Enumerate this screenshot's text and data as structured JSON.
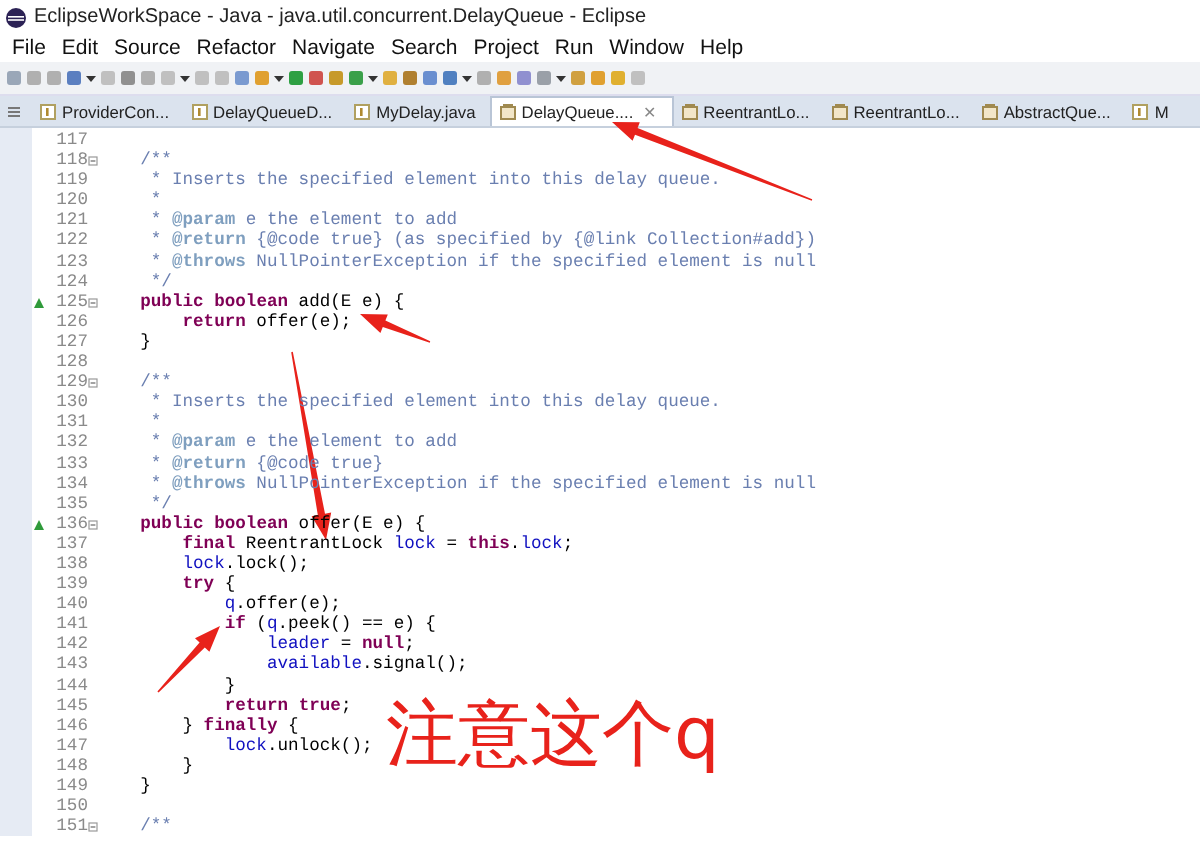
{
  "window": {
    "title": "EclipseWorkSpace - Java - java.util.concurrent.DelayQueue - Eclipse"
  },
  "menu": [
    "File",
    "Edit",
    "Source",
    "Refactor",
    "Navigate",
    "Search",
    "Project",
    "Run",
    "Window",
    "Help"
  ],
  "tabs": [
    {
      "label": "ProviderCon...",
      "kind": "source",
      "selected": false
    },
    {
      "label": "DelayQueueD...",
      "kind": "source",
      "selected": false
    },
    {
      "label": "MyDelay.java",
      "kind": "source",
      "selected": false
    },
    {
      "label": "DelayQueue....",
      "kind": "class",
      "selected": true,
      "close": "✕"
    },
    {
      "label": "ReentrantLo...",
      "kind": "class",
      "selected": false
    },
    {
      "label": "ReentrantLo...",
      "kind": "class",
      "selected": false
    },
    {
      "label": "AbstractQue...",
      "kind": "class",
      "selected": false
    },
    {
      "label": "M",
      "kind": "source",
      "selected": false
    }
  ],
  "editor": {
    "lines": [
      {
        "n": "117",
        "fold": false,
        "override": false
      },
      {
        "n": "118",
        "fold": true,
        "override": false,
        "tokens": [
          {
            "kind": "comment",
            "text": "    /**"
          }
        ]
      },
      {
        "n": "119",
        "fold": false,
        "override": false,
        "tokens": [
          {
            "kind": "comment",
            "text": "     * Inserts the specified element into this delay queue."
          }
        ]
      },
      {
        "n": "120",
        "fold": false,
        "override": false,
        "tokens": [
          {
            "kind": "comment",
            "text": "     *"
          }
        ]
      },
      {
        "n": "121",
        "fold": false,
        "override": false,
        "tokens": [
          {
            "kind": "comment",
            "text": "     * "
          },
          {
            "kind": "tag",
            "text": "@param"
          },
          {
            "kind": "comment",
            "text": " e the element to add"
          }
        ]
      },
      {
        "n": "122",
        "fold": false,
        "override": false,
        "tokens": [
          {
            "kind": "comment",
            "text": "     * "
          },
          {
            "kind": "tag",
            "text": "@return"
          },
          {
            "kind": "comment",
            "text": " {@code true} (as specified by {@link Collection#add})"
          }
        ]
      },
      {
        "n": "123",
        "fold": false,
        "override": false,
        "tokens": [
          {
            "kind": "comment",
            "text": "     * "
          },
          {
            "kind": "tag",
            "text": "@throws"
          },
          {
            "kind": "comment",
            "text": " NullPointerException if the specified element is null"
          }
        ]
      },
      {
        "n": "124",
        "fold": false,
        "override": false,
        "tokens": [
          {
            "kind": "comment",
            "text": "     */"
          }
        ]
      },
      {
        "n": "125",
        "fold": true,
        "override": true,
        "tokens": [
          {
            "kind": "keyword",
            "text": "    public "
          },
          {
            "kind": "keyword",
            "text": "boolean"
          },
          {
            "kind": "plain",
            "text": " add(E e) {"
          }
        ]
      },
      {
        "n": "126",
        "fold": false,
        "override": false,
        "tokens": [
          {
            "kind": "keyword",
            "text": "        return"
          },
          {
            "kind": "plain",
            "text": " offer(e);"
          }
        ]
      },
      {
        "n": "127",
        "fold": false,
        "override": false,
        "tokens": [
          {
            "kind": "plain",
            "text": "    }"
          }
        ]
      },
      {
        "n": "128",
        "fold": false,
        "override": false
      },
      {
        "n": "129",
        "fold": true,
        "override": false,
        "tokens": [
          {
            "kind": "comment",
            "text": "    /**"
          }
        ]
      },
      {
        "n": "130",
        "fold": false,
        "override": false,
        "tokens": [
          {
            "kind": "comment",
            "text": "     * Inserts the specified element into this delay queue."
          }
        ]
      },
      {
        "n": "131",
        "fold": false,
        "override": false,
        "tokens": [
          {
            "kind": "comment",
            "text": "     *"
          }
        ]
      },
      {
        "n": "132",
        "fold": false,
        "override": false,
        "tokens": [
          {
            "kind": "comment",
            "text": "     * "
          },
          {
            "kind": "tag",
            "text": "@param"
          },
          {
            "kind": "comment",
            "text": " e the element to add"
          }
        ]
      },
      {
        "n": "133",
        "fold": false,
        "override": false,
        "tokens": [
          {
            "kind": "comment",
            "text": "     * "
          },
          {
            "kind": "tag",
            "text": "@return"
          },
          {
            "kind": "comment",
            "text": " {@code true}"
          }
        ]
      },
      {
        "n": "134",
        "fold": false,
        "override": false,
        "tokens": [
          {
            "kind": "comment",
            "text": "     * "
          },
          {
            "kind": "tag",
            "text": "@throws"
          },
          {
            "kind": "comment",
            "text": " NullPointerException if the specified element is null"
          }
        ]
      },
      {
        "n": "135",
        "fold": false,
        "override": false,
        "tokens": [
          {
            "kind": "comment",
            "text": "     */"
          }
        ]
      },
      {
        "n": "136",
        "fold": true,
        "override": true,
        "tokens": [
          {
            "kind": "keyword",
            "text": "    public "
          },
          {
            "kind": "keyword",
            "text": "boolean"
          },
          {
            "kind": "plain",
            "text": " offer(E e) {"
          }
        ]
      },
      {
        "n": "137",
        "fold": false,
        "override": false,
        "tokens": [
          {
            "kind": "keyword",
            "text": "        final"
          },
          {
            "kind": "plain",
            "text": " ReentrantLock "
          },
          {
            "kind": "field",
            "text": "lock"
          },
          {
            "kind": "plain",
            "text": " = "
          },
          {
            "kind": "keyword",
            "text": "this"
          },
          {
            "kind": "plain",
            "text": "."
          },
          {
            "kind": "field",
            "text": "lock"
          },
          {
            "kind": "plain",
            "text": ";"
          }
        ]
      },
      {
        "n": "138",
        "fold": false,
        "override": false,
        "tokens": [
          {
            "kind": "field",
            "text": "        lock"
          },
          {
            "kind": "plain",
            "text": ".lock();"
          }
        ]
      },
      {
        "n": "139",
        "fold": false,
        "override": false,
        "tokens": [
          {
            "kind": "keyword",
            "text": "        try"
          },
          {
            "kind": "plain",
            "text": " {"
          }
        ]
      },
      {
        "n": "140",
        "fold": false,
        "override": false,
        "tokens": [
          {
            "kind": "field",
            "text": "            q"
          },
          {
            "kind": "plain",
            "text": ".offer(e);"
          }
        ]
      },
      {
        "n": "141",
        "fold": false,
        "override": false,
        "tokens": [
          {
            "kind": "keyword",
            "text": "            if"
          },
          {
            "kind": "plain",
            "text": " ("
          },
          {
            "kind": "field",
            "text": "q"
          },
          {
            "kind": "plain",
            "text": ".peek() == e) {"
          }
        ]
      },
      {
        "n": "142",
        "fold": false,
        "override": false,
        "tokens": [
          {
            "kind": "field",
            "text": "                leader"
          },
          {
            "kind": "plain",
            "text": " = "
          },
          {
            "kind": "keyword",
            "text": "null"
          },
          {
            "kind": "plain",
            "text": ";"
          }
        ]
      },
      {
        "n": "143",
        "fold": false,
        "override": false,
        "tokens": [
          {
            "kind": "field",
            "text": "                available"
          },
          {
            "kind": "plain",
            "text": ".signal();"
          }
        ]
      },
      {
        "n": "144",
        "fold": false,
        "override": false,
        "tokens": [
          {
            "kind": "plain",
            "text": "            }"
          }
        ]
      },
      {
        "n": "145",
        "fold": false,
        "override": false,
        "tokens": [
          {
            "kind": "keyword",
            "text": "            return "
          },
          {
            "kind": "keyword",
            "text": "true"
          },
          {
            "kind": "plain",
            "text": ";"
          }
        ]
      },
      {
        "n": "146",
        "fold": false,
        "override": false,
        "tokens": [
          {
            "kind": "plain",
            "text": "        } "
          },
          {
            "kind": "keyword",
            "text": "finally"
          },
          {
            "kind": "plain",
            "text": " {"
          }
        ]
      },
      {
        "n": "147",
        "fold": false,
        "override": false,
        "tokens": [
          {
            "kind": "field",
            "text": "            lock"
          },
          {
            "kind": "plain",
            "text": ".unlock();"
          }
        ]
      },
      {
        "n": "148",
        "fold": false,
        "override": false,
        "tokens": [
          {
            "kind": "plain",
            "text": "        }"
          }
        ]
      },
      {
        "n": "149",
        "fold": false,
        "override": false,
        "tokens": [
          {
            "kind": "plain",
            "text": "    }"
          }
        ]
      },
      {
        "n": "150",
        "fold": false,
        "override": false
      },
      {
        "n": "151",
        "fold": true,
        "override": false,
        "tokens": [
          {
            "kind": "comment",
            "text": "    /**"
          }
        ]
      }
    ]
  },
  "annotation": {
    "note": "注意这个q"
  }
}
